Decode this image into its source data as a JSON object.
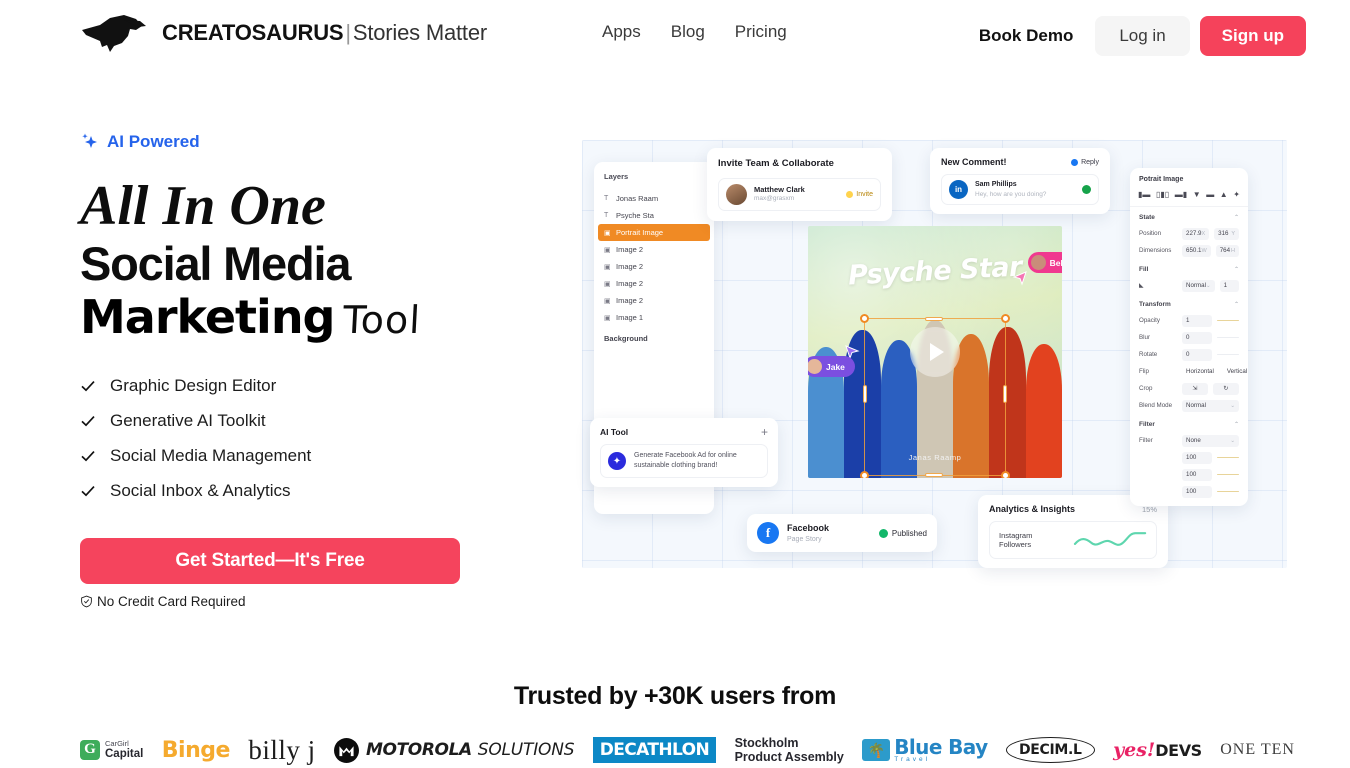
{
  "header": {
    "brand": {
      "name": "CREATOSAURUS",
      "separator": "|",
      "tagline": "Stories Matter",
      "logo_icon": "dinosaur-logo"
    },
    "nav": [
      {
        "label": "Apps"
      },
      {
        "label": "Blog"
      },
      {
        "label": "Pricing"
      }
    ],
    "book_demo": "Book Demo",
    "login": "Log in",
    "signup": "Sign up",
    "signup_color": "#f5425b"
  },
  "hero": {
    "badge": {
      "icon": "sparkle-icon",
      "label": "AI Powered",
      "color": "#2563eb"
    },
    "headline": {
      "line1": "All In One",
      "line2": "Social Media",
      "line3_bold": "Marketing",
      "line3_script": "Tool"
    },
    "features": [
      {
        "label": "Graphic Design Editor"
      },
      {
        "label": "Generative AI Toolkit"
      },
      {
        "label": "Social Media Management"
      },
      {
        "label": "Social Inbox & Analytics"
      }
    ],
    "cta": {
      "label": "Get Started—It's Free",
      "color": "#f5445d"
    },
    "no_credit_card": "No Credit Card Required"
  },
  "editor_mock": {
    "layers_panel": {
      "title": "Layers",
      "items": [
        {
          "glyph": "T",
          "label": "Jonas Raam",
          "active": false
        },
        {
          "glyph": "T",
          "label": "Psyche Sta",
          "active": false
        },
        {
          "glyph": "▣",
          "label": "Portrait Image",
          "active": true
        },
        {
          "glyph": "▣",
          "label": "Image 2",
          "active": false
        },
        {
          "glyph": "▣",
          "label": "Image 2",
          "active": false
        },
        {
          "glyph": "▣",
          "label": "Image 2",
          "active": false
        },
        {
          "glyph": "▣",
          "label": "Image 2",
          "active": false
        },
        {
          "glyph": "▣",
          "label": "Image 1",
          "active": false
        }
      ],
      "background_label": "Background",
      "active_color": "#f08a24"
    },
    "invite_card": {
      "title": "Invite Team & Collaborate",
      "person_name": "Matthew Clark",
      "person_email": "max@grasxm",
      "invite_label": "Invite"
    },
    "comment_card": {
      "title": "New Comment!",
      "reply_label": "Reply",
      "platform_icon": "linkedin-icon",
      "platform_short": "in",
      "person_name": "Sam Phillips",
      "message": "Hey, how are you doing?"
    },
    "canvas": {
      "title_text": "Psyche Star",
      "caption": "Janas Raamp",
      "play_icon": "play-button-icon",
      "cursors": [
        {
          "name": "Jake",
          "color": "#7b4fe0"
        },
        {
          "name": "Bella",
          "color": "#f0398f"
        }
      ]
    },
    "ai_tool_card": {
      "title": "AI Tool",
      "add_icon": "plus-icon",
      "prompt": "Generate Facebook Ad for online sustainable clothing brand!"
    },
    "facebook_card": {
      "platform": "Facebook",
      "subtitle": "Page Story",
      "status": "Published",
      "status_color": "#12b76a"
    },
    "analytics_card": {
      "title": "Analytics & Insights",
      "percent": "15%",
      "metric_label": "Instagram Followers",
      "line_color": "#5ed6ae"
    },
    "properties_panel": {
      "title": "Potrait Image",
      "align_icons": [
        "align-left-icon",
        "align-center-h-icon",
        "align-right-icon",
        "align-top-icon",
        "align-middle-icon",
        "align-bottom-icon",
        "distribute-icon"
      ],
      "sections": [
        {
          "name": "State",
          "rows": [
            {
              "label": "Position",
              "value1": "227.9",
              "unit1": "X",
              "value2": "316",
              "unit2": "Y"
            },
            {
              "label": "Dimensions",
              "value1": "650.1",
              "unit1": "W",
              "value2": "764",
              "unit2": "H"
            }
          ]
        },
        {
          "name": "Fill",
          "rows": [
            {
              "label": "",
              "value1": "Normal",
              "unit1": "",
              "value2": "1",
              "unit2": ""
            }
          ]
        },
        {
          "name": "Transform",
          "rows": [
            {
              "label": "Opacity",
              "value1": "1",
              "unit1": "",
              "value2": "",
              "unit2": ""
            },
            {
              "label": "Blur",
              "value1": "0",
              "unit1": "",
              "value2": "",
              "unit2": ""
            },
            {
              "label": "Rotate",
              "value1": "0",
              "unit1": "",
              "value2": "",
              "unit2": ""
            },
            {
              "label": "Flip",
              "value1": "Horizontal",
              "unit1": "",
              "value2": "Vertical",
              "unit2": ""
            },
            {
              "label": "Crop",
              "value1": "⇲",
              "unit1": "",
              "value2": "↻",
              "unit2": ""
            },
            {
              "label": "Blend Mode",
              "value1": "Normal",
              "unit1": "⌄",
              "value2": "",
              "unit2": ""
            }
          ]
        },
        {
          "name": "Filter",
          "rows": [
            {
              "label": "Filter",
              "value1": "None",
              "unit1": "⌄",
              "value2": "",
              "unit2": ""
            },
            {
              "label": "",
              "value1": "100",
              "unit1": "",
              "value2": "",
              "unit2": ""
            },
            {
              "label": "",
              "value1": "100",
              "unit1": "",
              "value2": "",
              "unit2": ""
            },
            {
              "label": "",
              "value1": "100",
              "unit1": "",
              "value2": "",
              "unit2": ""
            }
          ]
        }
      ]
    }
  },
  "trusted": {
    "title": "Trusted by +30K users from",
    "logos": [
      {
        "name": "CarGirl Capital",
        "line1": "CarGirl",
        "line2": "Capital",
        "mark": "G"
      },
      {
        "name": "Binge",
        "text": "Binge"
      },
      {
        "name": "billy j",
        "text": "billy j"
      },
      {
        "name": "Motorola Solutions",
        "text1": "MOTOROLA",
        "text2": "SOLUTIONS",
        "mark": "M"
      },
      {
        "name": "Decathlon",
        "text": "DECATHLON"
      },
      {
        "name": "Stockholm Product Assembly",
        "line1": "Stockholm",
        "line2": "Product Assembly"
      },
      {
        "name": "Blue Bay Travel",
        "text1": "Blue Bay",
        "text2": "Travel"
      },
      {
        "name": "DECIM.L",
        "text": "DECIM.L"
      },
      {
        "name": "yes! DEVS",
        "text1": "yes!",
        "text2": "DEVS"
      },
      {
        "name": "ONE TEN",
        "text": "ONE TEN"
      }
    ]
  }
}
